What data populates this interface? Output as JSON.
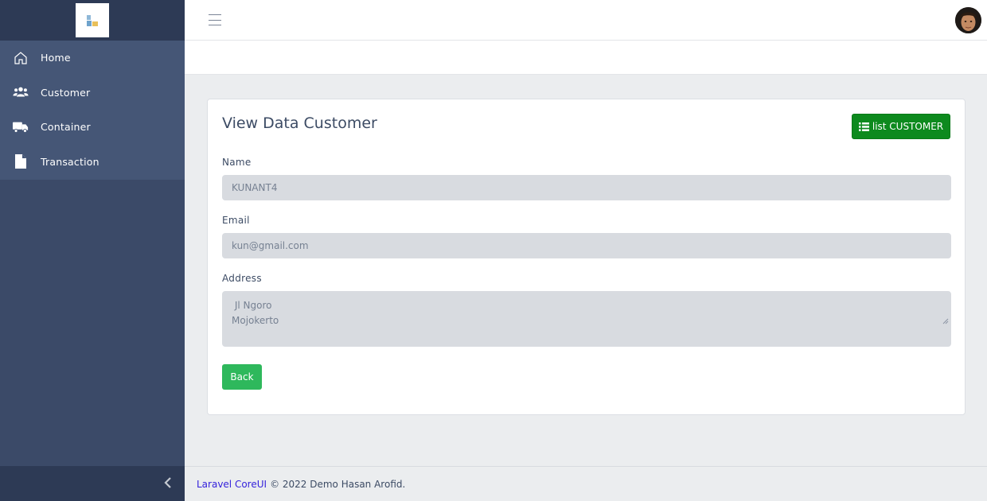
{
  "sidebar": {
    "items": [
      {
        "label": "Home",
        "icon": "home-icon"
      },
      {
        "label": "Customer",
        "icon": "users-icon"
      },
      {
        "label": "Container",
        "icon": "truck-icon"
      },
      {
        "label": "Transaction",
        "icon": "file-icon"
      }
    ]
  },
  "card": {
    "title": "View Data Customer",
    "list_button": "list CUSTOMER",
    "fields": {
      "name": {
        "label": "Name",
        "value": "KUNANT4"
      },
      "email": {
        "label": "Email",
        "value": "kun@gmail.com"
      },
      "address": {
        "label": "Address",
        "value": " Jl Ngoro\nMojokerto"
      }
    },
    "back_button": "Back"
  },
  "footer": {
    "link": "Laravel CoreUI",
    "text": "© 2022 Demo Hasan Arofid."
  },
  "colors": {
    "sidebar": "#3b4a68",
    "primary_green": "#0d8a1e",
    "success": "#2eb85c",
    "link": "#321fdb"
  }
}
